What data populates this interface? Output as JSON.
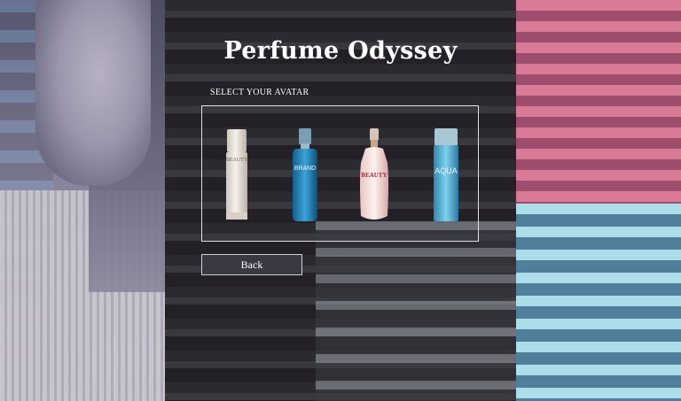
{
  "header": {
    "title": "Perfume Odyssey"
  },
  "avatar_section": {
    "label": "SELECT YOUR AVATAR",
    "avatars": [
      {
        "icon": "white-perfume-bottle-icon",
        "text": "BEAUTY",
        "color": "#e9e4de"
      },
      {
        "icon": "blue-perfume-bottle-icon",
        "text": "BRAND",
        "color": "#1f7fb5"
      },
      {
        "icon": "pink-perfume-bottle-icon",
        "text": "BEAUTY",
        "color": "#f0d8d4"
      },
      {
        "icon": "aqua-perfume-bottle-icon",
        "text": "AQUA",
        "color": "#42a8d0"
      }
    ]
  },
  "actions": {
    "back_label": "Back"
  }
}
